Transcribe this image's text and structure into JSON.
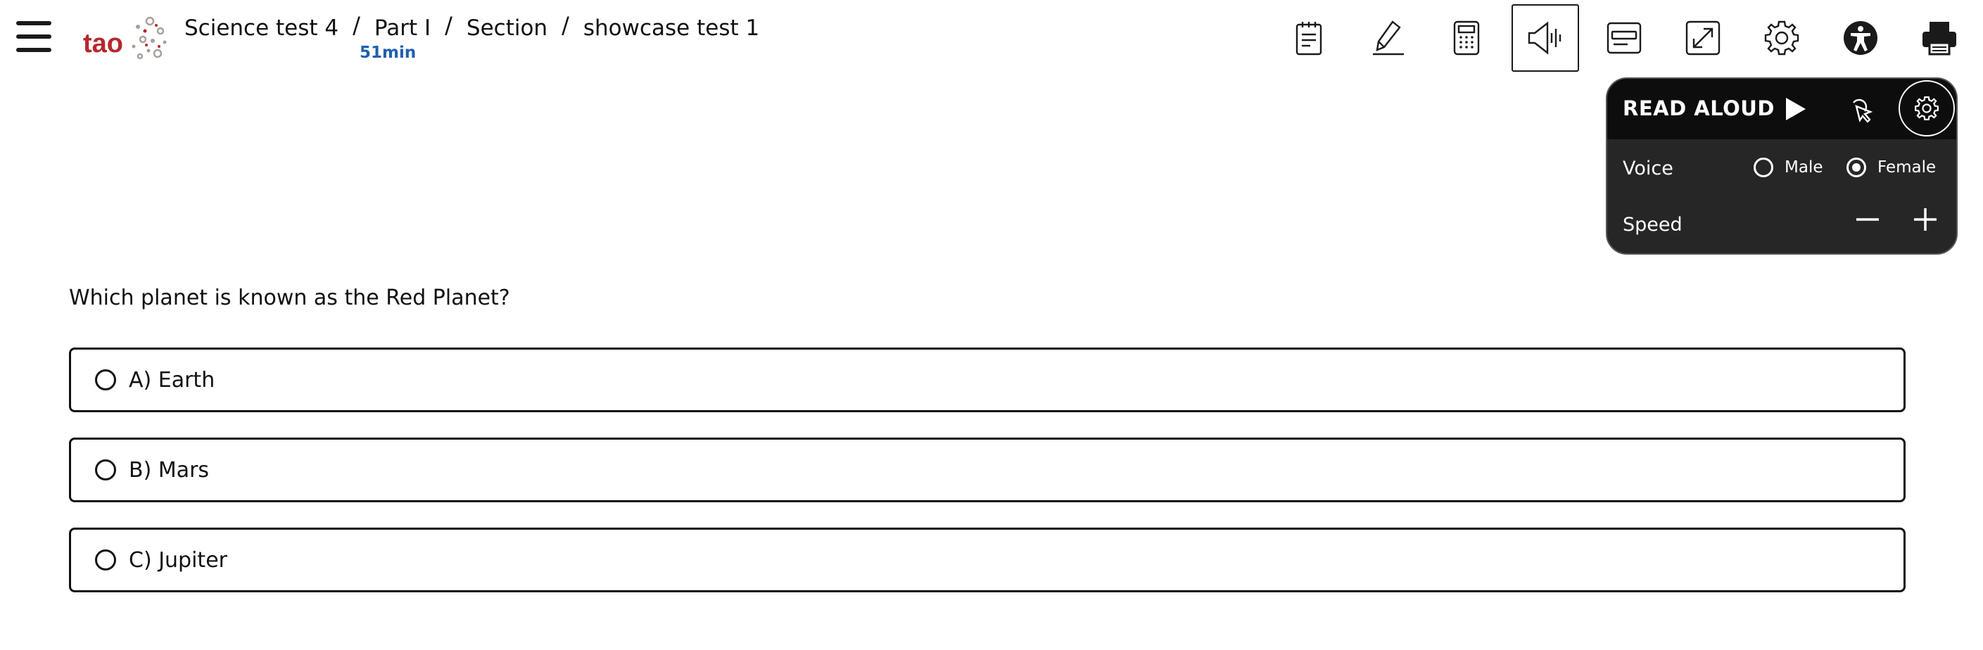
{
  "header": {
    "logo_text": "tao",
    "breadcrumb": [
      "Science test 4",
      "Part I",
      "Section",
      "showcase test 1"
    ],
    "breadcrumb_separator": "/",
    "timer": "51min"
  },
  "toolbar": {
    "tools": [
      {
        "name": "notepad-icon"
      },
      {
        "name": "highlighter-icon"
      },
      {
        "name": "calculator-icon"
      },
      {
        "name": "read-aloud-icon",
        "active": true
      },
      {
        "name": "line-reader-icon"
      },
      {
        "name": "fullscreen-icon"
      },
      {
        "name": "settings-icon"
      },
      {
        "name": "accessibility-icon"
      },
      {
        "name": "print-icon"
      }
    ]
  },
  "read_aloud": {
    "title": "READ ALOUD",
    "voice_label": "Voice",
    "voice_options": [
      "Male",
      "Female"
    ],
    "voice_selected": "Female",
    "speed_label": "Speed"
  },
  "question": {
    "prompt": "Which planet is known as the Red Planet?",
    "choices": [
      "A) Earth",
      "B) Mars",
      "C) Jupiter"
    ]
  },
  "colors": {
    "timer": "#1f5fae",
    "logo_red": "#b5282e",
    "panel_bg": "#262626",
    "panel_header": "#0d0d0d"
  }
}
